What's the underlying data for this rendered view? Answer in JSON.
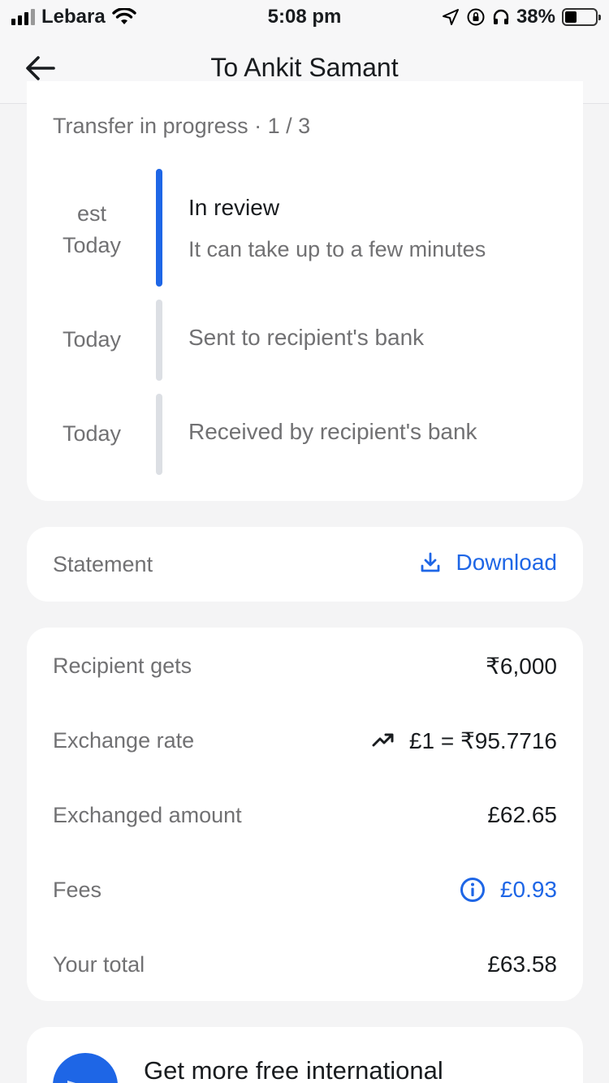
{
  "status_bar": {
    "carrier": "Lebara",
    "time": "5:08 pm",
    "battery": "38%",
    "battery_level": 0.38
  },
  "header": {
    "title": "To Ankit Samant",
    "back_icon": "arrow-left-icon"
  },
  "progress": {
    "title": "Transfer in progress · 1 / 3",
    "steps": [
      {
        "date_top": "est",
        "date": "Today",
        "title": "In review",
        "subtitle": "It can take up to a few minutes",
        "active": true
      },
      {
        "date": "Today",
        "title": "Sent to recipient's bank",
        "active": false
      },
      {
        "date": "Today",
        "title": "Received by recipient's bank",
        "active": false
      }
    ]
  },
  "statement": {
    "label": "Statement",
    "download_label": "Download",
    "download_icon": "download-icon"
  },
  "details": {
    "rows": [
      {
        "label": "Recipient gets",
        "value": "₹6,000"
      },
      {
        "label": "Exchange rate",
        "value": "£1 = ₹95.7716",
        "icon": "trending-up-icon"
      },
      {
        "label": "Exchanged amount",
        "value": "£62.65"
      },
      {
        "label": "Fees",
        "value": "£0.93",
        "icon": "info-icon"
      },
      {
        "label": "Your total",
        "value": "£63.58"
      }
    ]
  },
  "promo": {
    "text": "Get more free international"
  },
  "colors": {
    "accent": "#1e66e6",
    "muted_text": "#717173",
    "primary_text": "#191c1f",
    "background": "#f4f4f5"
  }
}
